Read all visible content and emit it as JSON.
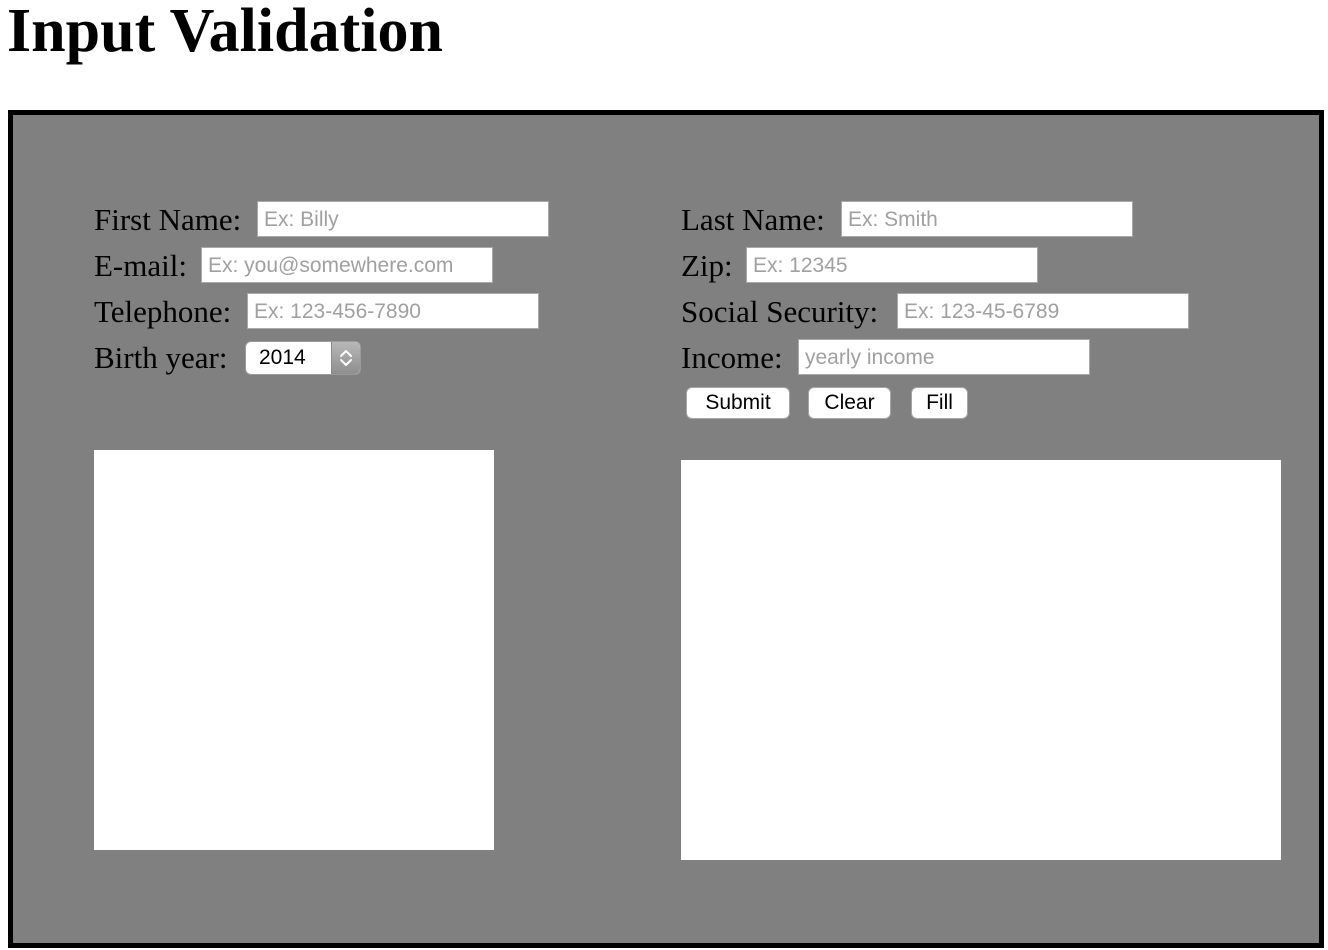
{
  "page": {
    "title": "Input Validation"
  },
  "form": {
    "first_name": {
      "label": "First Name:",
      "placeholder": "Ex: Billy",
      "value": ""
    },
    "last_name": {
      "label": "Last Name:",
      "placeholder": "Ex: Smith",
      "value": ""
    },
    "email": {
      "label": "E-mail:",
      "placeholder": "Ex: you@somewhere.com",
      "value": ""
    },
    "zip": {
      "label": "Zip:",
      "placeholder": "Ex: 12345",
      "value": ""
    },
    "telephone": {
      "label": "Telephone:",
      "placeholder": "Ex: 123-456-7890",
      "value": ""
    },
    "social_security": {
      "label": "Social Security:",
      "placeholder": "Ex: 123-45-6789",
      "value": ""
    },
    "birth_year": {
      "label": "Birth year:",
      "value": "2014"
    },
    "income": {
      "label": "Income:",
      "placeholder": "yearly income",
      "value": ""
    }
  },
  "buttons": {
    "submit": "Submit",
    "clear": "Clear",
    "fill": "Fill"
  },
  "colors": {
    "panel_background": "#808080",
    "panel_border": "#000000",
    "output_background": "#ffffff"
  },
  "icons": {
    "stepper": "up-down-chevron-icon"
  }
}
